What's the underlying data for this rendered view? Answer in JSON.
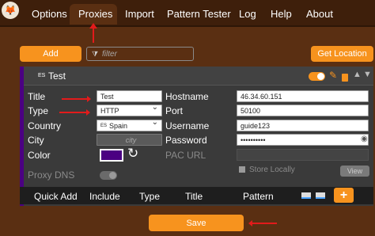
{
  "nav": {
    "logo": "🦊",
    "items": [
      {
        "label": "Options"
      },
      {
        "label": "Proxies"
      },
      {
        "label": "Import"
      },
      {
        "label": "Pattern Tester"
      },
      {
        "label": "Log"
      },
      {
        "label": "Help"
      },
      {
        "label": "About"
      }
    ]
  },
  "toolbar": {
    "add_label": "Add",
    "filter_placeholder": "filter",
    "get_location_label": "Get Location"
  },
  "proxy": {
    "flag": "ES",
    "name": "Test",
    "title_label": "Title",
    "title_value": "Test",
    "type_label": "Type",
    "type_value": "HTTP",
    "country_label": "Country",
    "country_flag": "ES",
    "country_value": "Spain",
    "city_label": "City",
    "city_placeholder": "city",
    "color_label": "Color",
    "color_value": "#4b0082",
    "proxy_dns_label": "Proxy DNS",
    "hostname_label": "Hostname",
    "hostname_value": "46.34.60.151",
    "port_label": "Port",
    "port_value": "50100",
    "username_label": "Username",
    "username_value": "guide123",
    "password_label": "Password",
    "password_value": "••••••••••",
    "pac_url_label": "PAC URL",
    "store_locally_label": "Store Locally",
    "view_label": "View"
  },
  "table": {
    "headers": [
      "Quick Add",
      "Include",
      "Type",
      "Title",
      "Pattern"
    ],
    "add_symbol": "+"
  },
  "footer": {
    "save_label": "Save"
  },
  "colors": {
    "accent": "#f7931e",
    "background": "#5a2f12",
    "arrow": "#e21b1b",
    "proxy_color": "#4b0082"
  }
}
